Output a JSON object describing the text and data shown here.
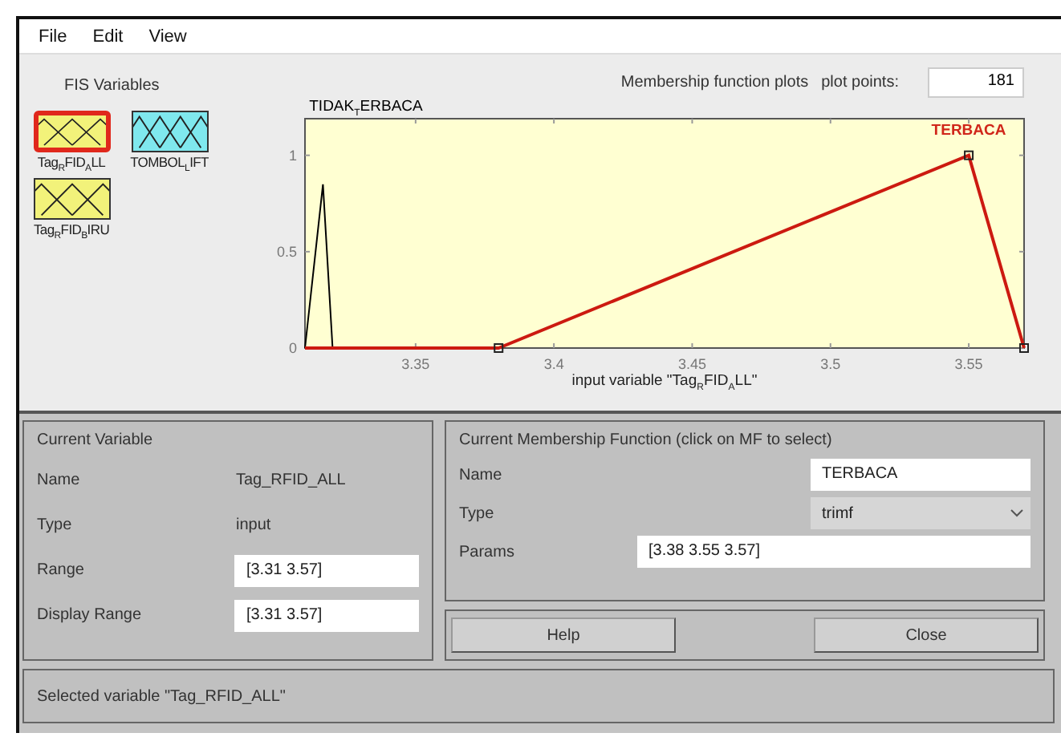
{
  "menu": [
    "File",
    "Edit",
    "View"
  ],
  "fis_variables": {
    "title": "FIS Variables",
    "items": [
      {
        "label": "Tag$_{R}$FID$_{A}$LL",
        "color": "#f2f27a",
        "selected": true
      },
      {
        "label": "TOMBOL$_{L}$IFT",
        "color": "#7fe8ee",
        "selected": false
      },
      {
        "label": "Tag$_{R}$FID$_{B}$IRU",
        "color": "#f2f27a",
        "selected": false
      }
    ]
  },
  "plot": {
    "title": "Membership function plots",
    "plot_points_label": "plot points:",
    "plot_points": "181",
    "membership_functions": [
      {
        "selected": false
      },
      {
        "selected": true
      }
    ],
    "chart_data": {
      "type": "line",
      "xlabel": "input variable \"Tag$_{R}$FID$_{A}$LL\"",
      "x": [
        3.31,
        3.3165,
        3.32,
        3.38,
        3.55,
        3.57
      ],
      "series": [
        {
          "name": "TIDAK$_{T}$ERBACA",
          "color": "#000000",
          "values": [
            0,
            0.85,
            0,
            null,
            null,
            null
          ]
        },
        {
          "name": "TERBACA",
          "color": "#cc1a10",
          "values": [
            0,
            0,
            0,
            0,
            1,
            0
          ]
        }
      ],
      "xlim": [
        3.31,
        3.57
      ],
      "ylim": [
        0,
        1.19
      ],
      "xticks": [
        3.35,
        3.4,
        3.45,
        3.5,
        3.55
      ],
      "yticks": [
        0,
        0.5,
        1
      ]
    }
  },
  "current_variable": {
    "title": "Current Variable",
    "rows": [
      {
        "label": "Name",
        "value": "Tag_RFID_ALL",
        "kind": "text"
      },
      {
        "label": "Type",
        "value": "input",
        "kind": "text"
      },
      {
        "label": "Range",
        "value": "[3.31 3.57]",
        "kind": "field"
      },
      {
        "label": "Display Range",
        "value": "[3.31 3.57]",
        "kind": "field"
      }
    ]
  },
  "current_mf": {
    "title": "Current Membership Function (click on MF to select)",
    "rows": [
      {
        "label": "Name",
        "value": "TERBACA",
        "kind": "field"
      },
      {
        "label": "Type",
        "value": "trimf",
        "kind": "dropdown"
      },
      {
        "label": "Params",
        "value": "[3.38 3.55 3.57]",
        "kind": "wide_field"
      }
    ]
  },
  "buttons": [
    "Help",
    "Close"
  ],
  "status_bar": "Selected variable \"Tag_RFID_ALL\""
}
